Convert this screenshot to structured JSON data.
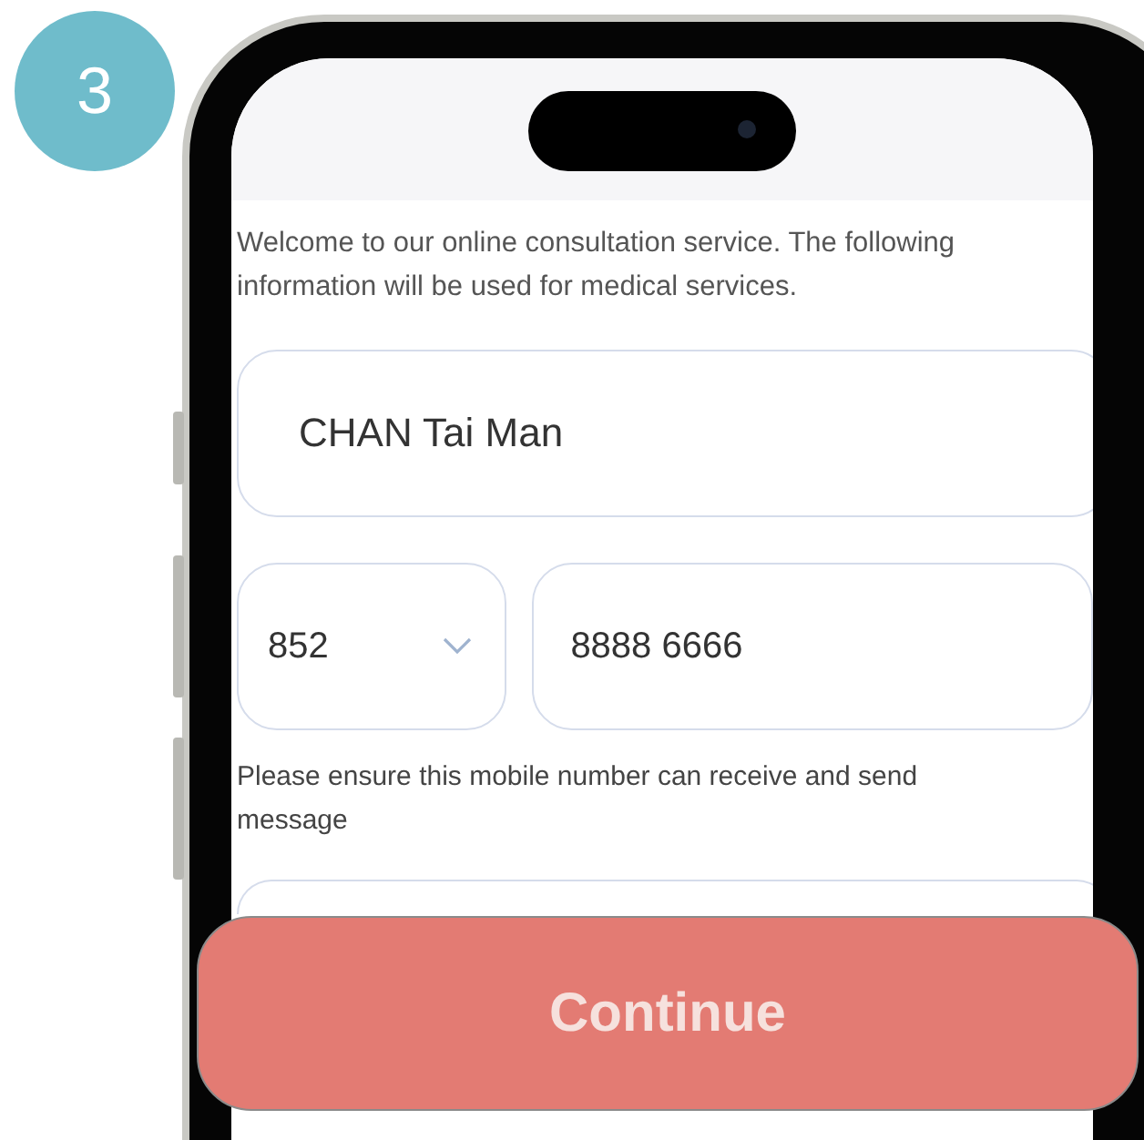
{
  "step_badge": "3",
  "intro": "Welcome to our online consultation service. The following information will be used for medical services.",
  "name_field": {
    "value": "CHAN Tai Man"
  },
  "country_code": {
    "value": "852"
  },
  "phone_field": {
    "value": "8888 6666"
  },
  "hint": "Please ensure this mobile number can receive and send message",
  "continue_button": {
    "label": "Continue",
    "disabled": true
  }
}
